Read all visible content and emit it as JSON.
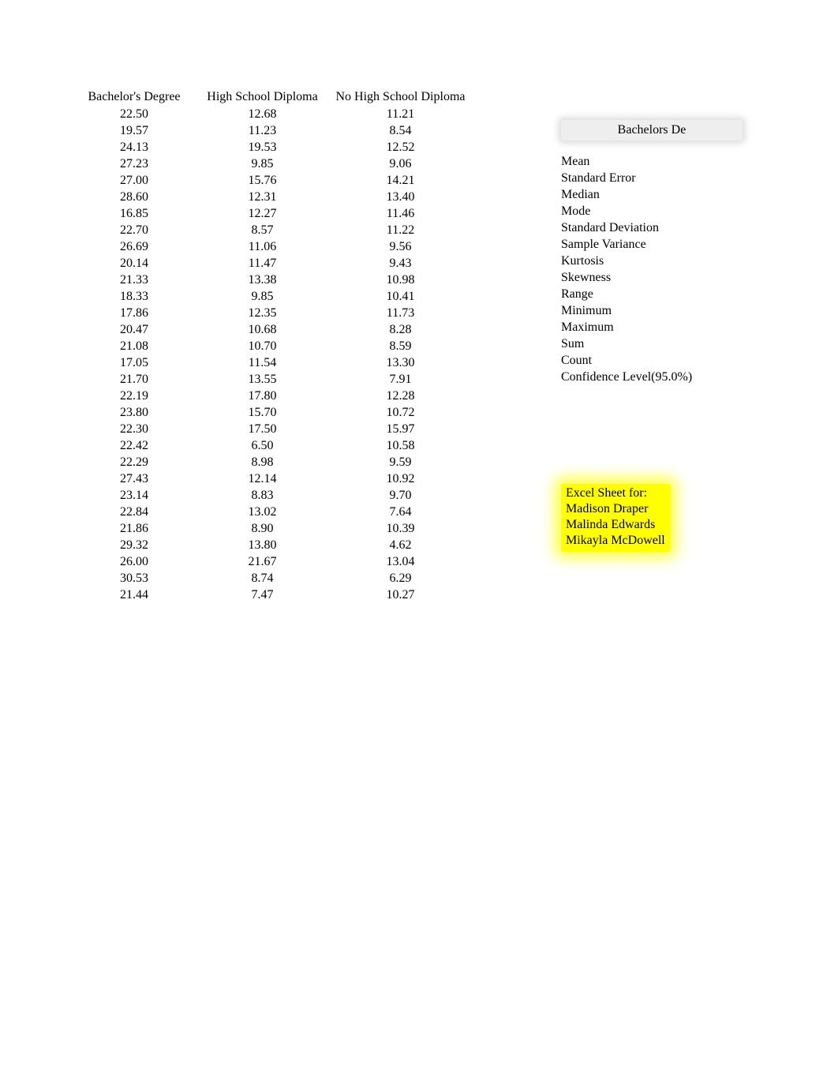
{
  "table": {
    "headers": [
      "Bachelor's Degree",
      "High School Diploma",
      "No High School Diploma"
    ],
    "rows": [
      [
        "22.50",
        "12.68",
        "11.21"
      ],
      [
        "19.57",
        "11.23",
        "8.54"
      ],
      [
        "24.13",
        "19.53",
        "12.52"
      ],
      [
        "27.23",
        "9.85",
        "9.06"
      ],
      [
        "27.00",
        "15.76",
        "14.21"
      ],
      [
        "28.60",
        "12.31",
        "13.40"
      ],
      [
        "16.85",
        "12.27",
        "11.46"
      ],
      [
        "22.70",
        "8.57",
        "11.22"
      ],
      [
        "26.69",
        "11.06",
        "9.56"
      ],
      [
        "20.14",
        "11.47",
        "9.43"
      ],
      [
        "21.33",
        "13.38",
        "10.98"
      ],
      [
        "18.33",
        "9.85",
        "10.41"
      ],
      [
        "17.86",
        "12.35",
        "11.73"
      ],
      [
        "20.47",
        "10.68",
        "8.28"
      ],
      [
        "21.08",
        "10.70",
        "8.59"
      ],
      [
        "17.05",
        "11.54",
        "13.30"
      ],
      [
        "21.70",
        "13.55",
        "7.91"
      ],
      [
        "22.19",
        "17.80",
        "12.28"
      ],
      [
        "23.80",
        "15.70",
        "10.72"
      ],
      [
        "22.30",
        "17.50",
        "15.97"
      ],
      [
        "22.42",
        "6.50",
        "10.58"
      ],
      [
        "22.29",
        "8.98",
        "9.59"
      ],
      [
        "27.43",
        "12.14",
        "10.92"
      ],
      [
        "23.14",
        "8.83",
        "9.70"
      ],
      [
        "22.84",
        "13.02",
        "7.64"
      ],
      [
        "21.86",
        "8.90",
        "10.39"
      ],
      [
        "29.32",
        "13.80",
        "4.62"
      ],
      [
        "26.00",
        "21.67",
        "13.04"
      ],
      [
        "30.53",
        "8.74",
        "6.29"
      ],
      [
        "21.44",
        "7.47",
        "10.27"
      ]
    ]
  },
  "stats": {
    "header": "Bachelors De",
    "labels": [
      "Mean",
      "Standard Error",
      "Median",
      "Mode",
      "Standard Deviation",
      "Sample Variance",
      "Kurtosis",
      "Skewness",
      "Range",
      "Minimum",
      "Maximum",
      "Sum",
      "Count",
      "Confidence Level(95.0%)"
    ]
  },
  "note": {
    "lines": [
      "Excel Sheet for:",
      "Madison Draper",
      "Malinda Edwards",
      "Mikayla McDowell"
    ]
  }
}
